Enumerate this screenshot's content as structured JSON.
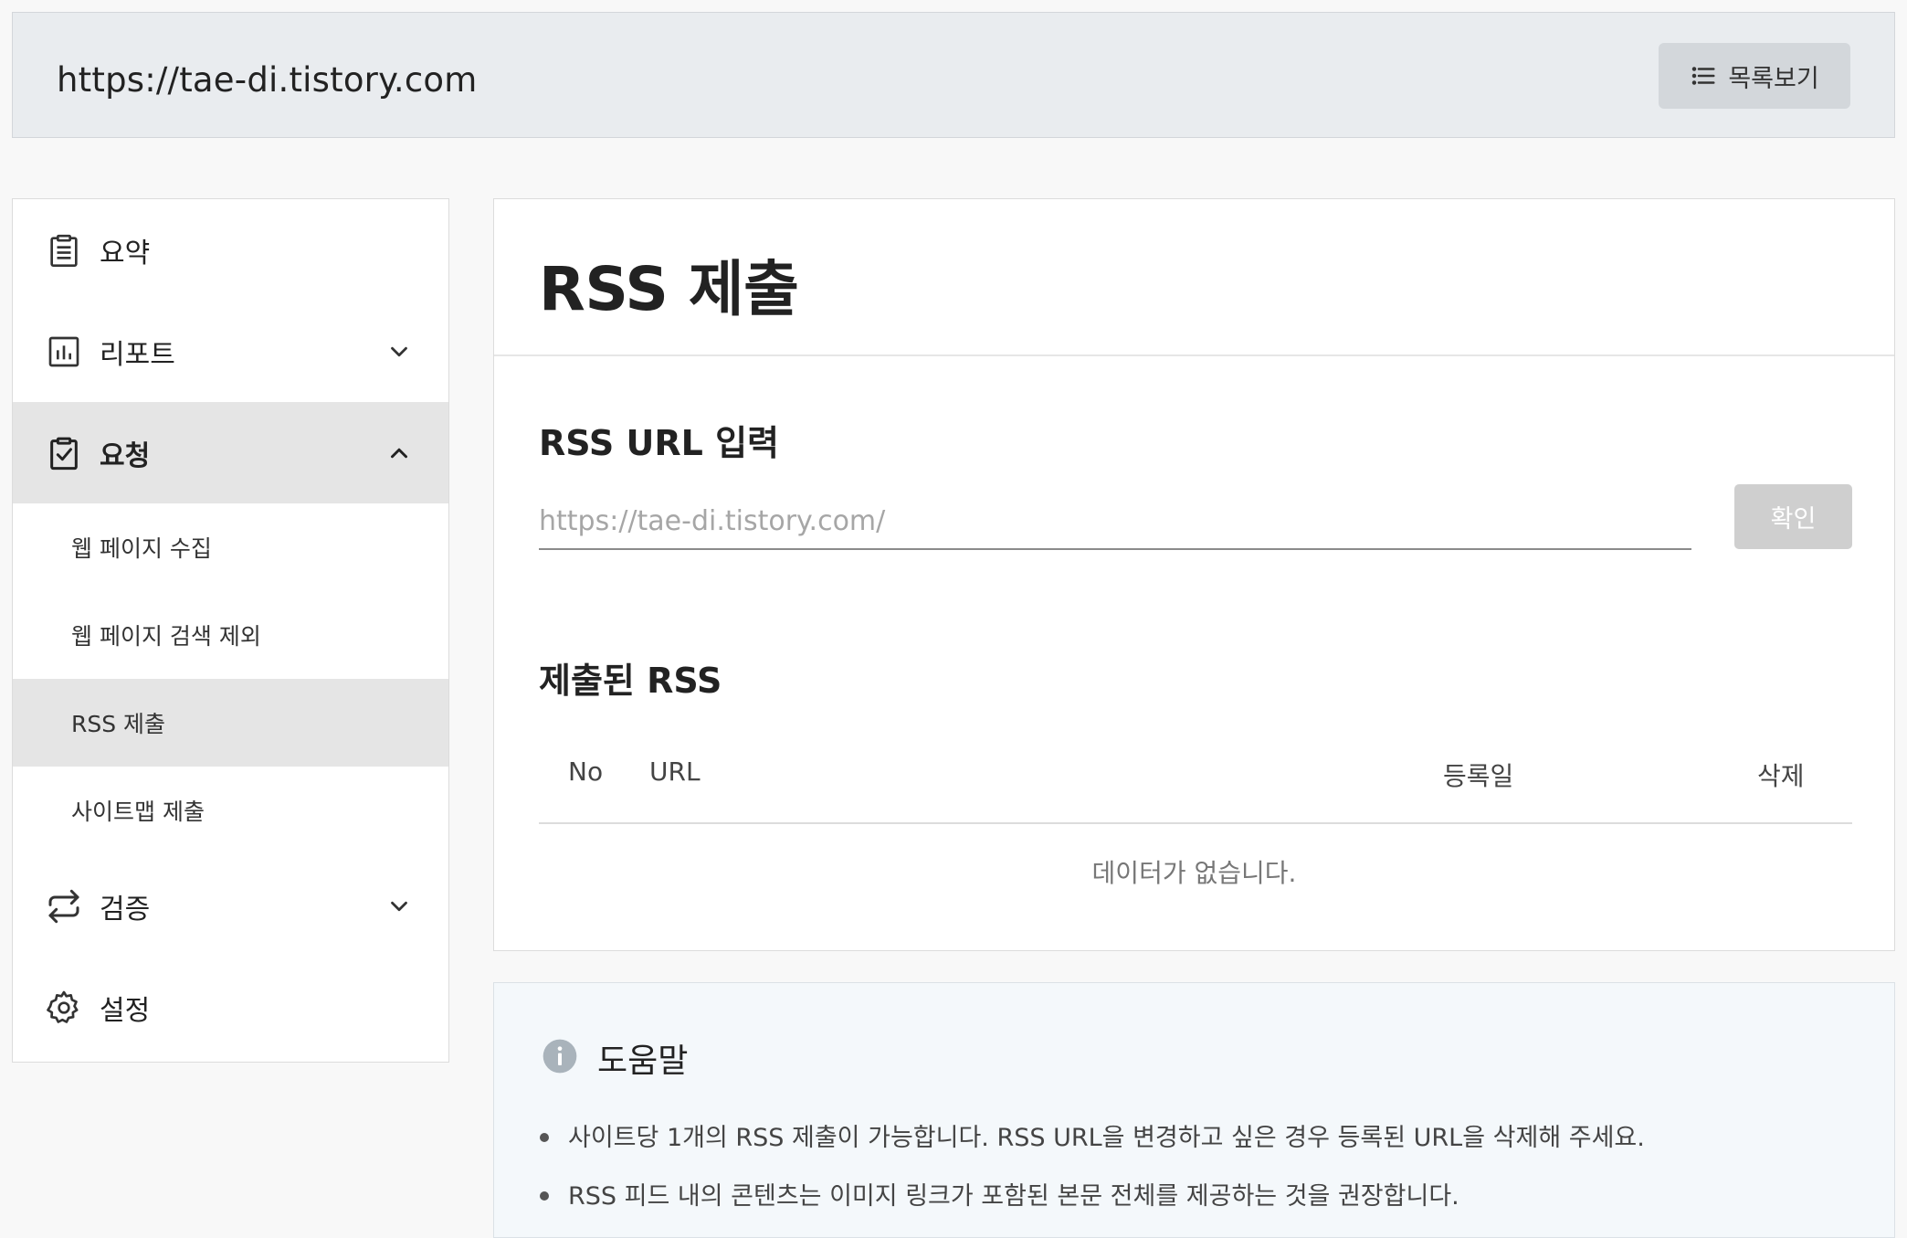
{
  "header": {
    "site_url": "https://tae-di.tistory.com",
    "list_button_label": "목록보기",
    "list_icon": "list-icon"
  },
  "sidebar": {
    "items": [
      {
        "label": "요약",
        "icon": "clipboard-list-icon"
      },
      {
        "label": "리포트",
        "icon": "bar-chart-icon",
        "expanded": false
      },
      {
        "label": "요청",
        "icon": "clipboard-check-icon",
        "expanded": true,
        "active": true
      },
      {
        "label": "검증",
        "icon": "repeat-arrows-icon",
        "expanded": false
      },
      {
        "label": "설정",
        "icon": "gear-icon"
      }
    ],
    "sub_items": [
      {
        "label": "웹 페이지 수집"
      },
      {
        "label": "웹 페이지 검색 제외"
      },
      {
        "label": "RSS 제출",
        "active": true
      },
      {
        "label": "사이트맵 제출"
      }
    ]
  },
  "main": {
    "title": "RSS 제출",
    "input_section_title": "RSS URL 입력",
    "input_placeholder": "https://tae-di.tistory.com/",
    "input_value": "",
    "confirm_label": "확인",
    "submitted_section_title": "제출된 RSS",
    "table": {
      "columns": [
        "No",
        "URL",
        "등록일",
        "삭제"
      ],
      "rows": [],
      "empty_message": "데이터가 없습니다."
    }
  },
  "help": {
    "title": "도움말",
    "icon": "info-icon",
    "items": [
      "사이트당 1개의 RSS 제출이 가능합니다. RSS URL을 변경하고 싶은 경우 등록된 URL을 삭제해 주세요.",
      "RSS 피드 내의 콘텐츠는 이미지 링크가 포함된 본문 전체를 제공하는 것을 권장합니다."
    ]
  },
  "colors": {
    "active_bg": "#e5e5e5",
    "header_bg": "#e9ecef",
    "disabled_button": "#cfcfcf",
    "help_bg": "#f4f8fb"
  }
}
